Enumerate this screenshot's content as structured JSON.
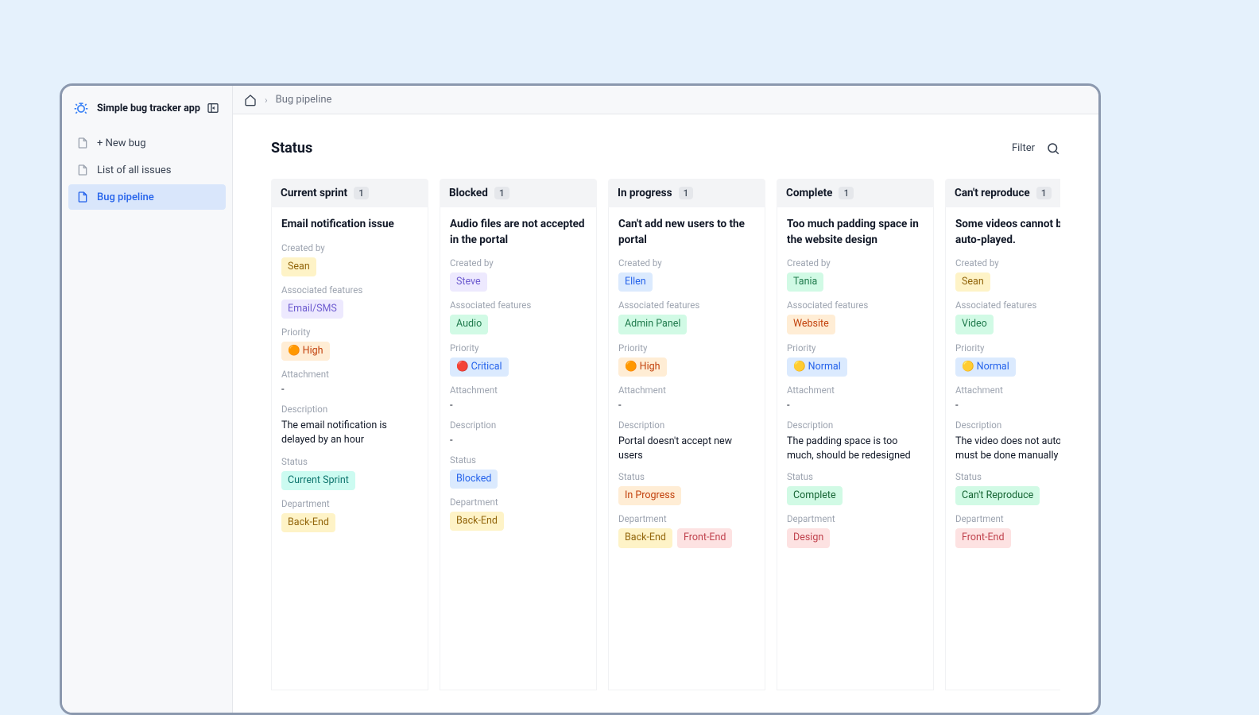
{
  "sidebar": {
    "title": "Simple bug tracker app",
    "nav": [
      {
        "label": "+ New bug"
      },
      {
        "label": "List of all issues"
      },
      {
        "label": "Bug pipeline"
      }
    ]
  },
  "breadcrumb": {
    "current": "Bug pipeline"
  },
  "page": {
    "title": "Status",
    "filter_label": "Filter"
  },
  "field_labels": {
    "created_by": "Created by",
    "features": "Associated features",
    "priority": "Priority",
    "attachment": "Attachment",
    "description": "Description",
    "status": "Status",
    "department": "Department"
  },
  "columns": [
    {
      "title": "Current sprint",
      "count": "1",
      "card": {
        "title": "Email notification issue",
        "creator": {
          "name": "Sean",
          "color": "c-yellow"
        },
        "feature": {
          "name": "Email/SMS",
          "color": "c-purple"
        },
        "priority": {
          "label": "🟠 High",
          "color": "c-orange"
        },
        "attachment": "-",
        "description": "The email notification is delayed by an hour",
        "status": {
          "label": "Current Sprint",
          "color": "c-teal"
        },
        "departments": [
          {
            "name": "Back-End",
            "color": "c-yellow"
          }
        ]
      }
    },
    {
      "title": "Blocked",
      "count": "1",
      "card": {
        "title": "Audio files are not accepted in the portal",
        "creator": {
          "name": "Steve",
          "color": "c-purple"
        },
        "feature": {
          "name": "Audio",
          "color": "c-green"
        },
        "priority": {
          "label": "🔴 Critical",
          "color": "c-blue"
        },
        "attachment": "-",
        "description": "-",
        "status": {
          "label": "Blocked",
          "color": "c-blue"
        },
        "departments": [
          {
            "name": "Back-End",
            "color": "c-yellow"
          }
        ]
      }
    },
    {
      "title": "In progress",
      "count": "1",
      "card": {
        "title": "Can't add new users to the portal",
        "creator": {
          "name": "Ellen",
          "color": "c-blue"
        },
        "feature": {
          "name": "Admin Panel",
          "color": "c-green"
        },
        "priority": {
          "label": "🟠 High",
          "color": "c-orange"
        },
        "attachment": "-",
        "description": "Portal doesn't accept new users",
        "status": {
          "label": "In Progress",
          "color": "c-orange"
        },
        "departments": [
          {
            "name": "Back-End",
            "color": "c-yellow"
          },
          {
            "name": "Front-End",
            "color": "c-red-soft"
          }
        ]
      }
    },
    {
      "title": "Complete",
      "count": "1",
      "card": {
        "title": "Too much padding space in the website design",
        "creator": {
          "name": "Tania",
          "color": "c-green"
        },
        "feature": {
          "name": "Website",
          "color": "c-orange"
        },
        "priority": {
          "label": "🟡 Normal",
          "color": "c-blue"
        },
        "attachment": "-",
        "description": "The padding space is too much, should be redesigned",
        "status": {
          "label": "Complete",
          "color": "c-green-dk"
        },
        "departments": [
          {
            "name": "Design",
            "color": "c-red-soft"
          }
        ]
      }
    },
    {
      "title": "Can't reproduce",
      "count": "1",
      "card": {
        "title": "Some videos cannot be auto-played.",
        "creator": {
          "name": "Sean",
          "color": "c-yellow"
        },
        "feature": {
          "name": "Video",
          "color": "c-green"
        },
        "priority": {
          "label": "🟡 Normal",
          "color": "c-blue"
        },
        "attachment": "-",
        "description": "The video does not autoplay. must be done manually",
        "status": {
          "label": "Can't Reproduce",
          "color": "c-green-dk"
        },
        "departments": [
          {
            "name": "Front-End",
            "color": "c-red-soft"
          }
        ]
      }
    }
  ]
}
